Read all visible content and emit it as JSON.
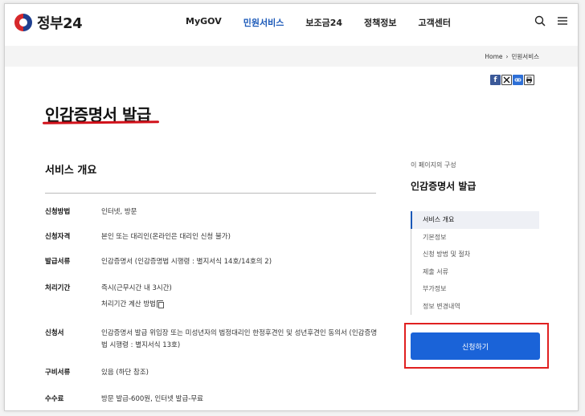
{
  "header": {
    "logo_text": "정부24",
    "nav": [
      "MyGOV",
      "민원서비스",
      "보조금24",
      "정책정보",
      "고객센터"
    ],
    "active_nav_index": 1,
    "icons": [
      "search-icon",
      "menu-icon"
    ]
  },
  "breadcrumb": {
    "home": "Home",
    "separator": "›",
    "current": "민원서비스"
  },
  "share_icons": [
    "facebook-icon",
    "x-icon",
    "link-icon",
    "print-icon"
  ],
  "page": {
    "title": "인감증명서 발급"
  },
  "overview": {
    "title": "서비스 개요",
    "rows": [
      {
        "label": "신청방법",
        "value": "인터넷, 방문"
      },
      {
        "label": "신청자격",
        "value": "본인 또는 대리인(온라인은 대리인 신청 불가)"
      },
      {
        "label": "발급서류",
        "value": "인감증명서 (인감증명법 시행령 : 별지서식 14호/14호의 2)"
      },
      {
        "label": "처리기간",
        "value": "즉시(근무시간 내 3시간)",
        "sub": "처리기간 계산 방법"
      },
      {
        "label": "신청서",
        "value": "인감증명서 발급 위임장 또는 미성년자의 법정대리인 한정후견인 및 성년후견인 동의서 (인감증명법 시행령 : 별지서식 13호)"
      },
      {
        "label": "구비서류",
        "value": "있음 (하단 참조)"
      },
      {
        "label": "수수료",
        "value": "방문 발급-600원, 인터넷 발급-무료"
      }
    ]
  },
  "sidebar": {
    "caption": "이 페이지의 구성",
    "title": "인감증명서 발급",
    "items": [
      "서비스 개요",
      "기본정보",
      "신청 방법 및 절차",
      "제출 서류",
      "부가정보",
      "정보 변경내역"
    ],
    "active_index": 0,
    "apply_label": "신청하기"
  },
  "colors": {
    "accent": "#1a58b8",
    "button": "#1a63d8",
    "highlight_box": "#e02020",
    "title_underline": "#d1111a"
  }
}
